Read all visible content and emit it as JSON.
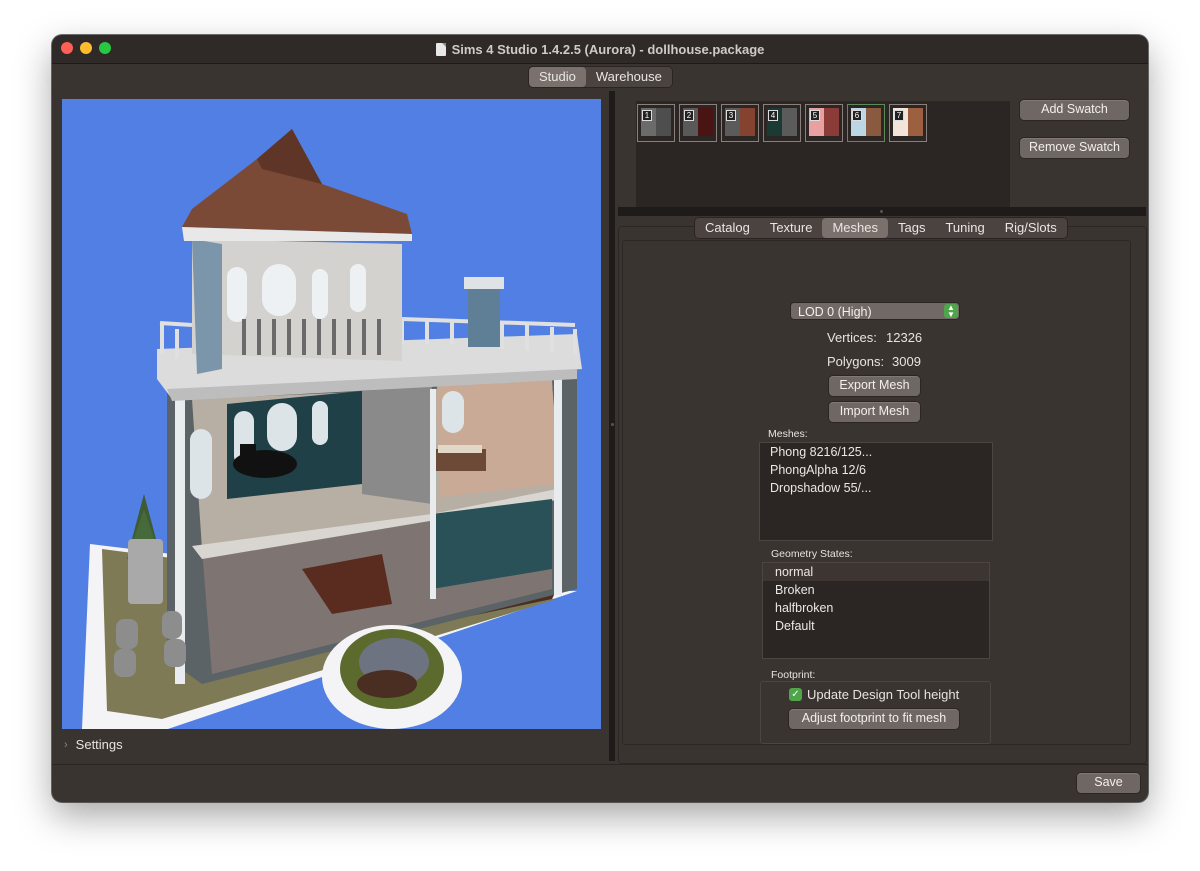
{
  "window": {
    "title": "Sims 4 Studio 1.4.2.5 (Aurora)  - dollhouse.package"
  },
  "modes": [
    {
      "label": "Studio",
      "selected": true
    },
    {
      "label": "Warehouse",
      "selected": false
    }
  ],
  "swatches": [
    {
      "number": "1",
      "colors": [
        "#6b6b6b",
        "#4e4e4e"
      ],
      "selected": false
    },
    {
      "number": "2",
      "colors": [
        "#595959",
        "#4b1414"
      ],
      "selected": false
    },
    {
      "number": "3",
      "colors": [
        "#5b5b5b",
        "#84432e"
      ],
      "selected": false
    },
    {
      "number": "4",
      "colors": [
        "#1a3a33",
        "#5b5b5b"
      ],
      "selected": false
    },
    {
      "number": "5",
      "colors": [
        "#e9a0a0",
        "#8c3c38"
      ],
      "selected": false
    },
    {
      "number": "6",
      "colors": [
        "#bcd6e6",
        "#8a5a40"
      ],
      "selected": true
    },
    {
      "number": "7",
      "colors": [
        "#f2e4d8",
        "#9c6040"
      ],
      "selected": false
    }
  ],
  "swatch_buttons": {
    "add": "Add Swatch",
    "remove": "Remove Swatch"
  },
  "tabs": [
    {
      "label": "Catalog",
      "selected": false
    },
    {
      "label": "Texture",
      "selected": false
    },
    {
      "label": "Meshes",
      "selected": true
    },
    {
      "label": "Tags",
      "selected": false
    },
    {
      "label": "Tuning",
      "selected": false
    },
    {
      "label": "Rig/Slots",
      "selected": false
    }
  ],
  "meshes_tab": {
    "lod_select": "LOD 0 (High)",
    "vertices_label": "Vertices:",
    "vertices_value": "12326",
    "polygons_label": "Polygons:",
    "polygons_value": "3009",
    "export_button": "Export Mesh",
    "import_button": "Import Mesh",
    "meshes_label": "Meshes:",
    "meshes": [
      "Phong 8216/125...",
      "PhongAlpha 12/6",
      "Dropshadow 55/..."
    ],
    "geometry_label": "Geometry States:",
    "geometry_states": [
      {
        "label": "normal",
        "selected": true
      },
      {
        "label": "Broken",
        "selected": false
      },
      {
        "label": "halfbroken",
        "selected": false
      },
      {
        "label": "Default",
        "selected": false
      }
    ],
    "footprint_label": "Footprint:",
    "update_height_label": "Update Design Tool height",
    "update_height_checked": true,
    "adjust_button": "Adjust footprint to fit mesh"
  },
  "settings_label": "Settings",
  "save_button": "Save"
}
